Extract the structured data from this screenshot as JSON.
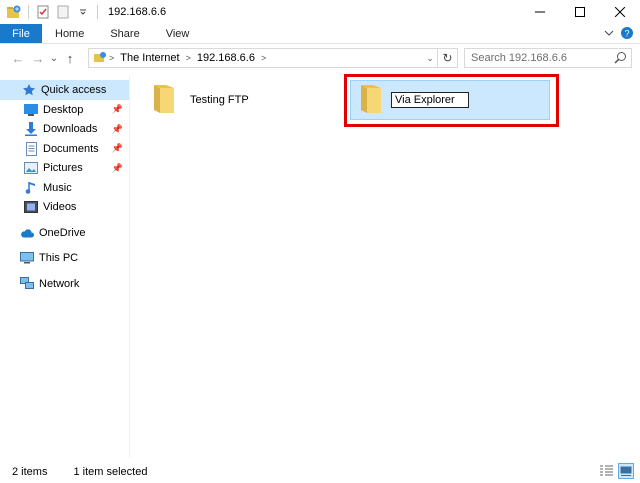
{
  "window": {
    "title": "192.168.6.6"
  },
  "ribbon": {
    "tabs": [
      "File",
      "Home",
      "Share",
      "View"
    ]
  },
  "nav": {
    "back": "←",
    "forward": "→",
    "recent": "⌄",
    "up": "↑"
  },
  "address": {
    "crumbs": [
      "The Internet",
      "192.168.6.6"
    ]
  },
  "search": {
    "placeholder": "Search 192.168.6.6"
  },
  "navpane": {
    "quick_access": "Quick access",
    "items": [
      "Desktop",
      "Downloads",
      "Documents",
      "Pictures",
      "Music",
      "Videos"
    ],
    "onedrive": "OneDrive",
    "thispc": "This PC",
    "network": "Network"
  },
  "content": {
    "items": [
      {
        "name": "Testing FTP"
      },
      {
        "name": "Via Explorer"
      }
    ]
  },
  "status": {
    "count": "2 items",
    "selected": "1 item selected"
  },
  "colors": {
    "accent": "#1979ca",
    "selection": "#cce8ff",
    "highlight_box": "#e00000",
    "folder": "#f7d674"
  }
}
